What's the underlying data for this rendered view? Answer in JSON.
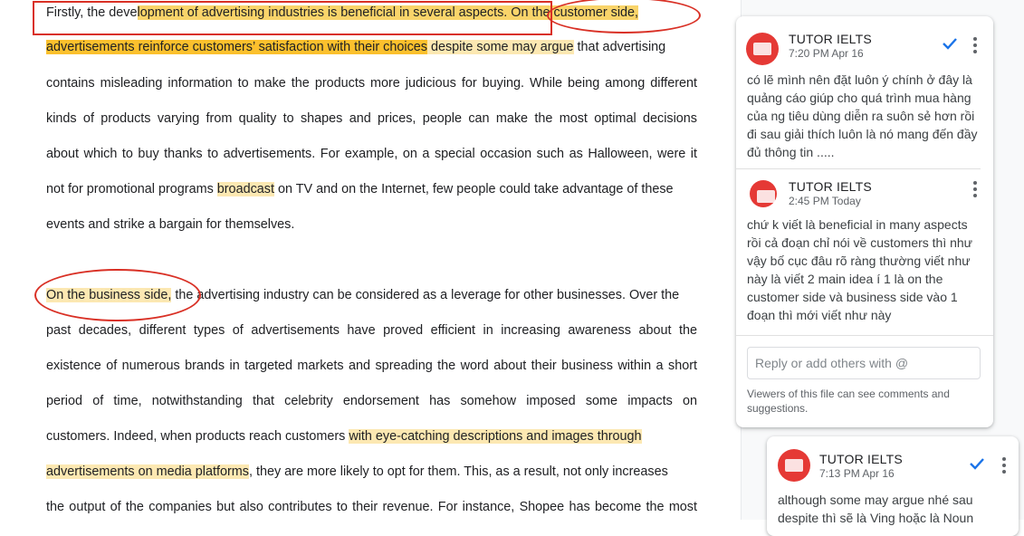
{
  "document": {
    "lines": [
      {
        "segments": [
          {
            "t": "Firstly, the deve",
            "hl": ""
          },
          {
            "t": "lopment of advertising industries is beneficial in several aspects.",
            "hl": "hlc"
          },
          {
            "t": " On the customer side,",
            "hl": "hlc"
          }
        ]
      },
      {
        "segments": [
          {
            "t": "advertisements reinforce customers’ satisfaction with their choices",
            "hl": "hl2"
          },
          {
            "t": " despite some may argue",
            "hl": "hl"
          },
          {
            "t": " that advertising",
            "hl": ""
          }
        ]
      },
      {
        "text": "contains misleading information to make the products more judicious for buying. While being among different"
      },
      {
        "text": "kinds of products varying from quality to shapes and prices, people can make the most optimal decisions"
      },
      {
        "text": "about which to buy thanks to advertisements. For example, on a special occasion such as Halloween, were it"
      },
      {
        "segments": [
          {
            "t": "not for promotional programs ",
            "hl": ""
          },
          {
            "t": "broadcast",
            "hl": "hl"
          },
          {
            "t": " on TV and on the Internet, few people could take advantage of these",
            "hl": ""
          }
        ]
      },
      {
        "text": "events and strike a bargain for themselves."
      },
      {
        "segments": [
          {
            "t": "On the business side,",
            "hl": "hl"
          },
          {
            "t": " the advertising industry can be considered as a leverage for other businesses. Over the",
            "hl": ""
          }
        ]
      },
      {
        "text": "past decades, different types of advertisements have proved efficient in increasing awareness about the"
      },
      {
        "text": "existence of numerous brands in targeted markets and spreading the word about their business within a short"
      },
      {
        "text": "period of time, notwithstanding that celebrity endorsement has somehow imposed some impacts on"
      },
      {
        "segments": [
          {
            "t": "customers. Indeed, when products reach customers ",
            "hl": ""
          },
          {
            "t": "with eye-catching descriptions and images through",
            "hl": "hl"
          }
        ]
      },
      {
        "segments": [
          {
            "t": "advertisements on media platforms",
            "hl": "hl"
          },
          {
            "t": ", they are more likely to opt for them. This, as a result, not only increases",
            "hl": ""
          }
        ]
      },
      {
        "text": "the output of the companies but also contributes to their revenue. For instance, Shopee has become the most"
      }
    ]
  },
  "comments": {
    "thread1": {
      "c1": {
        "author": "TUTOR IELTS",
        "time": "7:20 PM Apr 16",
        "body": "có lẽ mình nên đặt luôn ý chính ở đây là quảng cáo giúp cho quá trình mua hàng của ng tiêu dùng diễn ra suôn sẻ hơn rồi đi sau giải thích luôn là nó mang đến đầy đủ thông tin ....."
      },
      "c2": {
        "author": "TUTOR IELTS",
        "time": "2:45 PM Today",
        "body": "chứ k viết là beneficial in many aspects rồi cả đoạn chỉ nói về customers thì như vậy bố cục đâu rõ ràng thường viết như này là viết 2 main idea í 1 là on the customer side và business side vào 1 đoạn thì mới viết như này"
      },
      "reply_placeholder": "Reply or add others with @",
      "note": "Viewers of this file can see comments and suggestions."
    },
    "thread2": {
      "c1": {
        "author": "TUTOR IELTS",
        "time": "7:13 PM Apr 16",
        "body": "although some may argue nhé sau despite thì sẽ là Ving hoặc là Noun"
      }
    }
  },
  "colors": {
    "accent": "#1a73e8",
    "highlight_light": "#fce8b2",
    "highlight_strong": "#fbc02d",
    "annotation_red": "#d93025"
  },
  "icons": [
    "check-icon",
    "more-vert-icon",
    "avatar-logo"
  ]
}
